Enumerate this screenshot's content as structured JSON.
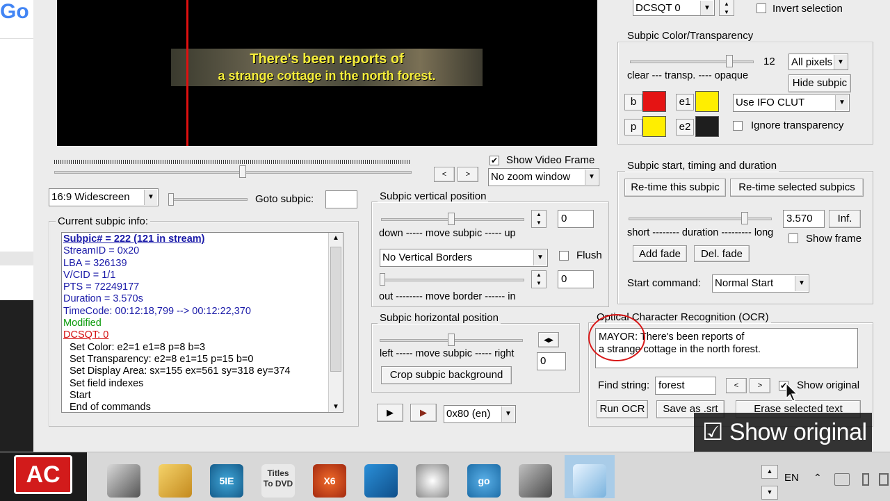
{
  "left_strip": {
    "logo_text": "Go"
  },
  "video": {
    "subtitle_line1": "There's been reports of",
    "subtitle_line2": "a strange cottage in the north forest."
  },
  "top_right": {
    "dcsqt_value": "DCSQT 0",
    "invert_label": "Invert selection"
  },
  "color_group": {
    "title": "Subpic Color/Transparency",
    "slider_value": "12",
    "pixels_select": "All pixels",
    "scale_label": "clear --- transp. ---- opaque",
    "hide_button": "Hide subpic",
    "clut_select": "Use IFO CLUT",
    "ignore_label": "Ignore transparency",
    "swatches": [
      {
        "label": "b",
        "color": "#e51414"
      },
      {
        "label": "e1",
        "color": "#ffee00"
      },
      {
        "label": "p",
        "color": "#ffee00"
      },
      {
        "label": "e2",
        "color": "#1e1e1e"
      }
    ]
  },
  "playback": {
    "show_video_frame": "Show Video Frame",
    "zoom_select": "No zoom window",
    "aspect_select": "16:9 Widescreen",
    "goto_label": "Goto subpic:",
    "goto_value": ""
  },
  "info_group": {
    "title": "Current subpic info:",
    "lines": [
      {
        "text": "Subpic# = 222 (121 in stream)",
        "style": "head"
      },
      {
        "text": "StreamID = 0x20",
        "style": "blue"
      },
      {
        "text": "LBA = 326139",
        "style": "blue"
      },
      {
        "text": "V/CID = 1/1",
        "style": "blue"
      },
      {
        "text": "PTS = 72249177",
        "style": "blue"
      },
      {
        "text": "Duration = 3.570s",
        "style": "blue"
      },
      {
        "text": "TimeCode: 00:12:18,799 --> 00:12:22,370",
        "style": "blue"
      },
      {
        "text": "Modified",
        "style": "green"
      },
      {
        "text": "DCSQT: 0",
        "style": "red"
      },
      {
        "text": "Set Color: e2=1 e1=8 p=8 b=3",
        "style": "cmd"
      },
      {
        "text": "Set Transparency: e2=8 e1=15 p=15 b=0",
        "style": "cmd"
      },
      {
        "text": "Set Display Area: sx=155 ex=561 sy=318 ey=374",
        "style": "cmd"
      },
      {
        "text": "Set field indexes",
        "style": "cmd"
      },
      {
        "text": "Start",
        "style": "cmd"
      },
      {
        "text": "End of commands",
        "style": "cmd"
      }
    ]
  },
  "vertical_group": {
    "title": "Subpic vertical position",
    "value1": "0",
    "scale1": "down ----- move subpic ----- up",
    "borders_select": "No Vertical Borders",
    "flush_label": "Flush",
    "value2": "0",
    "scale2": "out -------- move border ------ in"
  },
  "horizontal_group": {
    "title": "Subpic horizontal position",
    "scale": "left ----- move subpic ----- right",
    "value": "0",
    "crop_button": "Crop subpic background"
  },
  "bottom_controls": {
    "stream_select": "0x80 (en)"
  },
  "timing_group": {
    "title": "Subpic start, timing and duration",
    "retime_button": "Re-time this subpic",
    "retime_selected_button": "Re-time selected subpics",
    "duration_value": "3.570",
    "inf_button": "Inf.",
    "scale": "short -------- duration --------- long",
    "show_frame_label": "Show frame",
    "add_fade_button": "Add fade",
    "del_fade_button": "Del. fade",
    "start_command_label": "Start command:",
    "start_command_select": "Normal Start"
  },
  "ocr_group": {
    "title": "Optical Character Recognition (OCR)",
    "text_line1": "MAYOR: There's been reports of",
    "text_line2": "a strange cottage in the north forest.",
    "find_label": "Find string:",
    "find_value": "forest",
    "show_original_label": "Show original",
    "run_ocr_button": "Run OCR",
    "save_button": "Save as .srt",
    "erase_button": "Erase selected text"
  },
  "overlay": {
    "caption": "☑ Show original"
  },
  "taskbar": {
    "ac_logo": "AC",
    "language": "EN",
    "apps": [
      {
        "name": "app-film-editor",
        "label": ""
      },
      {
        "name": "app-media-converter",
        "label": ""
      },
      {
        "name": "app-5ie",
        "label": "5IE"
      },
      {
        "name": "app-titles-to-dvd",
        "label": "Titles To DVD"
      },
      {
        "name": "app-x6",
        "label": "X6"
      },
      {
        "name": "app-dvd-tool",
        "label": ""
      },
      {
        "name": "app-gimp",
        "label": ""
      },
      {
        "name": "app-goo",
        "label": "go"
      },
      {
        "name": "app-video-camera",
        "label": ""
      },
      {
        "name": "app-notepad",
        "label": ""
      }
    ]
  }
}
